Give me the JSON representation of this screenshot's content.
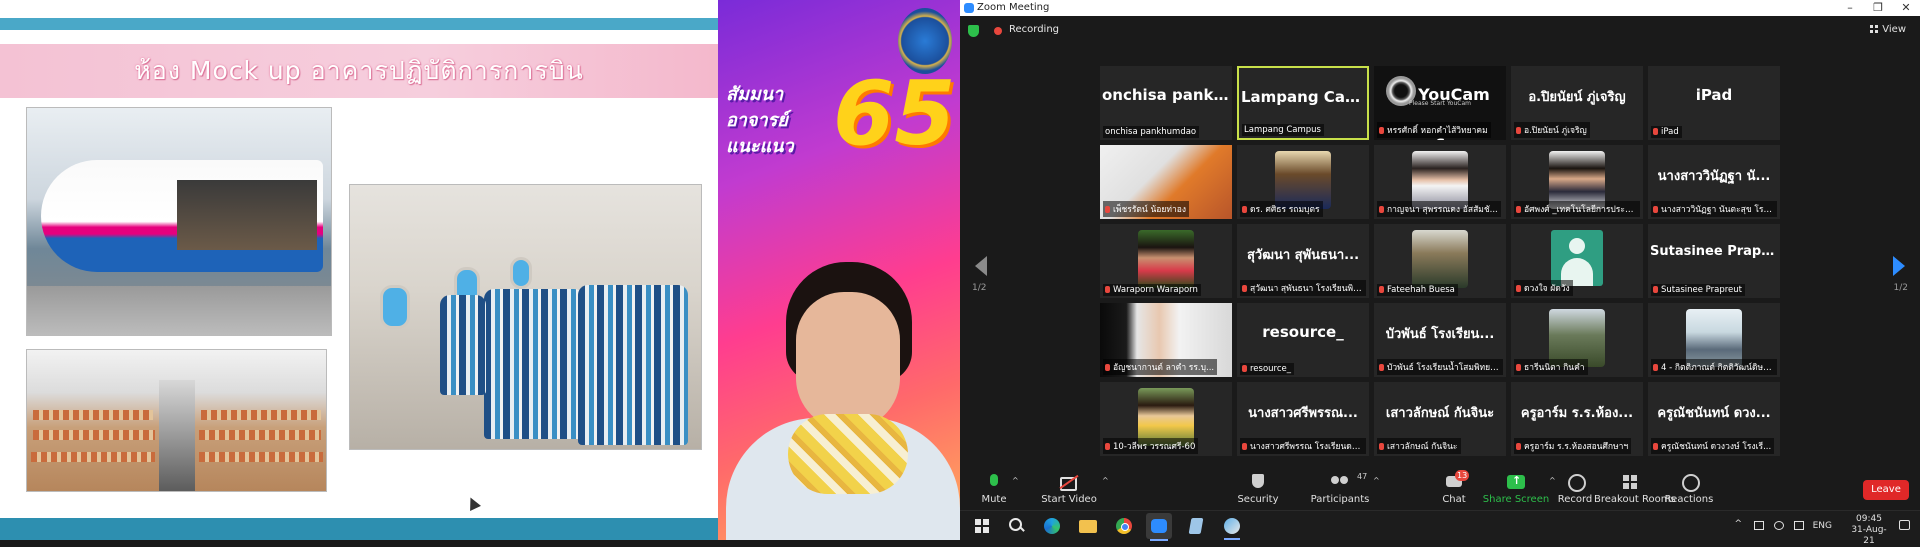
{
  "slide": {
    "title": "ห้อง Mock up อาคารปฏิบัติการการบิน"
  },
  "speaker": {
    "banner": "สัมมนา อาจารย์ แนะแนว",
    "number": "65"
  },
  "zoom": {
    "window_title": "Zoom Meeting",
    "window_controls": {
      "minimize": "–",
      "restore": "❐",
      "close": "✕"
    },
    "recording_label": "Recording",
    "view_label": "View",
    "page_left": "1/2",
    "page_right": "1/2",
    "tiles": [
      {
        "big": "onchisa  pankhu...",
        "label": "onchisa pankhumdao"
      },
      {
        "big": "Lampang Campus",
        "label": "Lampang Campus",
        "active": true
      },
      {
        "big": "YouCam 6",
        "sub": "Please Start YouCam",
        "label": "หรรศักดิ์ หอกคำไส้วิทยาคม"
      },
      {
        "big": "อ.ปิยนัยน์ ภู่เจริญ",
        "label": "อ.ปิยนัยน์ ภู่เจริญ"
      },
      {
        "big": "iPad",
        "label": "iPad"
      },
      {
        "big": "",
        "label": "เพ็ชรรัตน์ น้อยท่าอง"
      },
      {
        "big": "",
        "label": "ดร. ศศิธร รถมบุตร"
      },
      {
        "big": "",
        "label": "กาญจนา สุพรรณคง อัสสัมชั..."
      },
      {
        "big": "",
        "label": "อัศพงศ์ _เทคโนโลยีการประกอ..."
      },
      {
        "big": "นางสาววินัฏฐา นั...",
        "label": "นางสาววินัฏฐา นันตะสุข โรงเรี..."
      },
      {
        "big": "",
        "label": "Waraporn Waraporn"
      },
      {
        "big": "สุวัฒนา สุพันธนา...",
        "label": "สุวัฒนา สุพันธนา โรงเรียนพิบู..."
      },
      {
        "big": "",
        "label": "Fateehah  Buesa"
      },
      {
        "big": "",
        "label": "ดวงใจ ผัดวัง"
      },
      {
        "big": "Sutasinee  Prapr...",
        "label": "Sutasinee Prapreut"
      },
      {
        "big": "",
        "label": "อัญชนากานต์ ลาคำ รร.บุ..."
      },
      {
        "big": "resource_",
        "label": "resource_"
      },
      {
        "big": "บัวพันธ์ โรงเรียน...",
        "label": "บัวพันธ์ โรงเรียนน้ำโสมพิทยา..."
      },
      {
        "big": "",
        "label": "ธารีนนิตา กินคำ"
      },
      {
        "big": "",
        "label": "4 - กิตติภาณต์ กิตติวัฒน์ดิษย์ -..."
      },
      {
        "big": "",
        "label": "10-วลีพร วรรณศรี-60"
      },
      {
        "big": "นางสาวศรีพรรณ...",
        "label": "นางสาวศรีพรรณ โรงเรียนดาร..."
      },
      {
        "big": "เสาวลักษณ์ กันจินะ",
        "label": "เสาวลักษณ์ กันจินะ"
      },
      {
        "big": "ครูอาร์ม ร.ร.ห้อง...",
        "label": "ครูอาร์ม ร.ร.ห้องสอนศึกษาฯ"
      },
      {
        "big": "ครูณัชนันทน์ ดวง...",
        "label": "ครูณัชนันทน์ ดวงวงษ์ โรงเรี..."
      }
    ],
    "toolbar": {
      "mute": "Mute",
      "start_video": "Start Video",
      "security": "Security",
      "participants": "Participants",
      "participants_count": "47",
      "chat": "Chat",
      "chat_badge": "13",
      "share_screen": "Share Screen",
      "record": "Record",
      "breakout_rooms": "Breakout Rooms",
      "reactions": "Reactions",
      "leave": "Leave"
    },
    "colors": {
      "active_border": "#c8e04a",
      "share_green": "#2dbf4b",
      "leave_red": "#e02828",
      "accent_blue": "#2d8cff"
    }
  },
  "taskbar": {
    "icons": [
      "start-icon",
      "search-icon",
      "edge-icon",
      "folder-icon",
      "chrome-icon",
      "zoom-icon",
      "notes-icon",
      "tool-icon"
    ],
    "lang": "ENG",
    "time": "09:45",
    "date": "31-Aug-21"
  }
}
